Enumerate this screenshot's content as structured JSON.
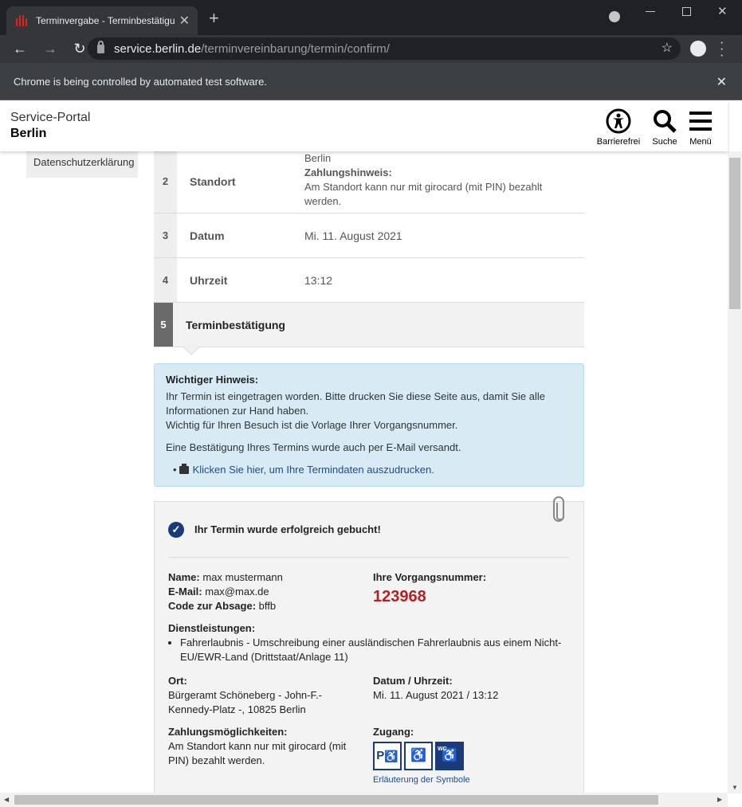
{
  "browser": {
    "tab_title": "Terminvergabe - Terminbestätigu",
    "tab_close": "✕",
    "new_tab": "+",
    "url_host": "service.berlin.de",
    "url_path": "/terminvereinbarung/termin/confirm/",
    "infobar_text": "Chrome is being controlled by automated test software.",
    "infobar_close": "✕"
  },
  "header": {
    "brand_line1": "Service-Portal",
    "brand_line2": "Berlin",
    "accessibility_label": "Barrierefrei",
    "search_label": "Suche",
    "menu_label": "Menü"
  },
  "sidebar": {
    "privacy_link": "Datenschutzerklärung"
  },
  "steps": [
    {
      "num": "2",
      "label": "Standort",
      "value_line1": "Berlin",
      "value_bold": "Zahlungshinweis:",
      "value_line3": "Am Standort kann nur mit girocard (mit PIN) bezahlt",
      "value_line4": "werden."
    },
    {
      "num": "3",
      "label": "Datum",
      "value": "Mi. 11. August 2021"
    },
    {
      "num": "4",
      "label": "Uhrzeit",
      "value": "13:12"
    },
    {
      "num": "5",
      "label": "Terminbestätigung"
    }
  ],
  "notice": {
    "heading": "Wichtiger Hinweis:",
    "line1": "Ihr Termin ist eingetragen worden. Bitte drucken Sie diese Seite aus, damit Sie alle",
    "line2": "Informationen zur Hand haben.",
    "line3": "Wichtig für Ihren Besuch ist die Vorlage Ihrer Vorgangsnummer.",
    "line4": "Eine Bestätigung Ihres Termins wurde auch per E-Mail versandt.",
    "print_link": "Klicken Sie hier, um Ihre Termindaten auszudrucken."
  },
  "card": {
    "success": "Ihr Termin wurde erfolgreich gebucht!",
    "name_label": "Name:",
    "name_value": "max mustermann",
    "email_label": "E-Mail:",
    "email_value": "max@max.de",
    "code_label": "Code zur Absage:",
    "code_value": "bffb",
    "vnum_label": "Ihre Vorgangsnummer:",
    "vnum_value": "123968",
    "services_label": "Dienstleistungen:",
    "service_item": "Fahrerlaubnis - Umschreibung einer ausländischen Fahrerlaubnis aus einem Nicht-EU/EWR-Land (Drittstaat/Anlage 11)",
    "ort_label": "Ort:",
    "ort_line1": "Bürgeramt Schöneberg - John-F.-",
    "ort_line2": "Kennedy-Platz -, 10825 Berlin",
    "datetime_label": "Datum / Uhrzeit:",
    "datetime_value": "Mi. 11. August 2021 / 13:12",
    "pay_label": "Zahlungsmöglichkeiten:",
    "pay_line1": "Am Standort kann nur mit girocard (mit",
    "pay_line2": "PIN) bezahlt werden.",
    "access_label": "Zugang:",
    "symbols_link": "Erläuterung der Symbole",
    "access_icons": [
      "parking-accessible-icon",
      "elevator-accessible-icon",
      "wc-accessible-icon"
    ],
    "access_p": "P",
    "access_wc": "WC"
  },
  "colors": {
    "accent": "#1b3a78",
    "vnum": "#b22222",
    "notice_bg": "#d8ebf5"
  }
}
